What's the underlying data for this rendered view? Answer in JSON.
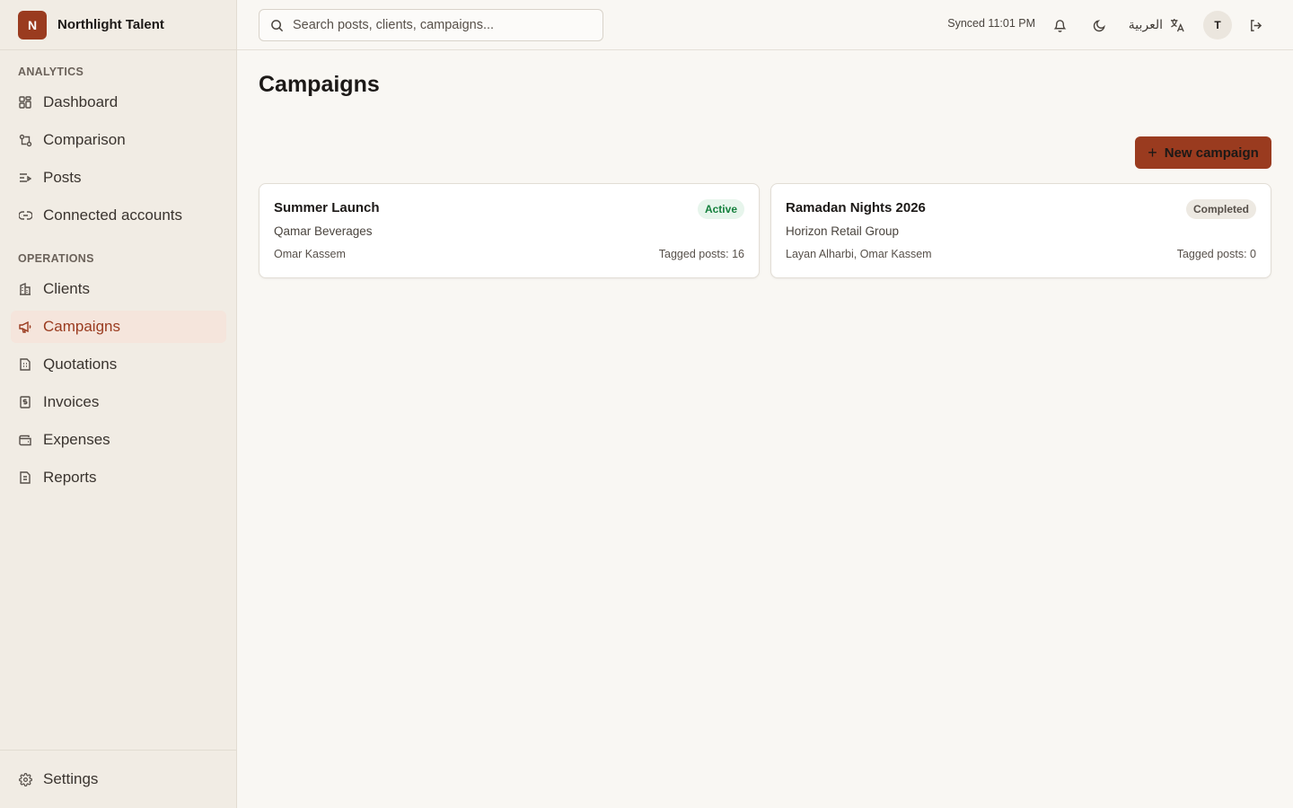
{
  "brand": {
    "initial": "N",
    "name": "Northlight Talent",
    "color": "#9a3b1f"
  },
  "sidebar": {
    "sections": [
      {
        "label": "ANALYTICS"
      },
      {
        "label": "OPERATIONS"
      }
    ],
    "items": [
      {
        "label": "Dashboard",
        "icon": "dashboard-icon"
      },
      {
        "label": "Comparison",
        "icon": "compare-icon"
      },
      {
        "label": "Posts",
        "icon": "posts-icon"
      },
      {
        "label": "Connected accounts",
        "icon": "link-icon"
      },
      {
        "label": "Clients",
        "icon": "building-icon"
      },
      {
        "label": "Campaigns",
        "icon": "megaphone-icon",
        "active": true
      },
      {
        "label": "Quotations",
        "icon": "document-icon"
      },
      {
        "label": "Invoices",
        "icon": "receipt-icon"
      },
      {
        "label": "Expenses",
        "icon": "wallet-icon"
      },
      {
        "label": "Reports",
        "icon": "report-icon"
      }
    ],
    "footer": {
      "label": "Settings",
      "icon": "gear-icon"
    }
  },
  "topbar": {
    "search_placeholder": "Search posts, clients, campaigns...",
    "synced": "Synced 11:01 PM",
    "language": "العربية",
    "avatar_initial": "T"
  },
  "main": {
    "title": "Campaigns",
    "new_button": "New campaign",
    "campaigns": [
      {
        "title": "Summer Launch",
        "status": "Active",
        "client": "Qamar Beverages",
        "people": "Omar Kassem",
        "tagged": "Tagged posts: 16"
      },
      {
        "title": "Ramadan Nights 2026",
        "status": "Completed",
        "client": "Horizon Retail Group",
        "people": "Layan Alharbi, Omar Kassem",
        "tagged": "Tagged posts: 0"
      }
    ]
  },
  "colors": {
    "accent": "#9a3b1f",
    "active_badge_bg": "#e7f5ec",
    "active_badge_text": "#15803d",
    "sidebar_bg": "#f1ece4",
    "page_bg": "#f9f7f3"
  }
}
